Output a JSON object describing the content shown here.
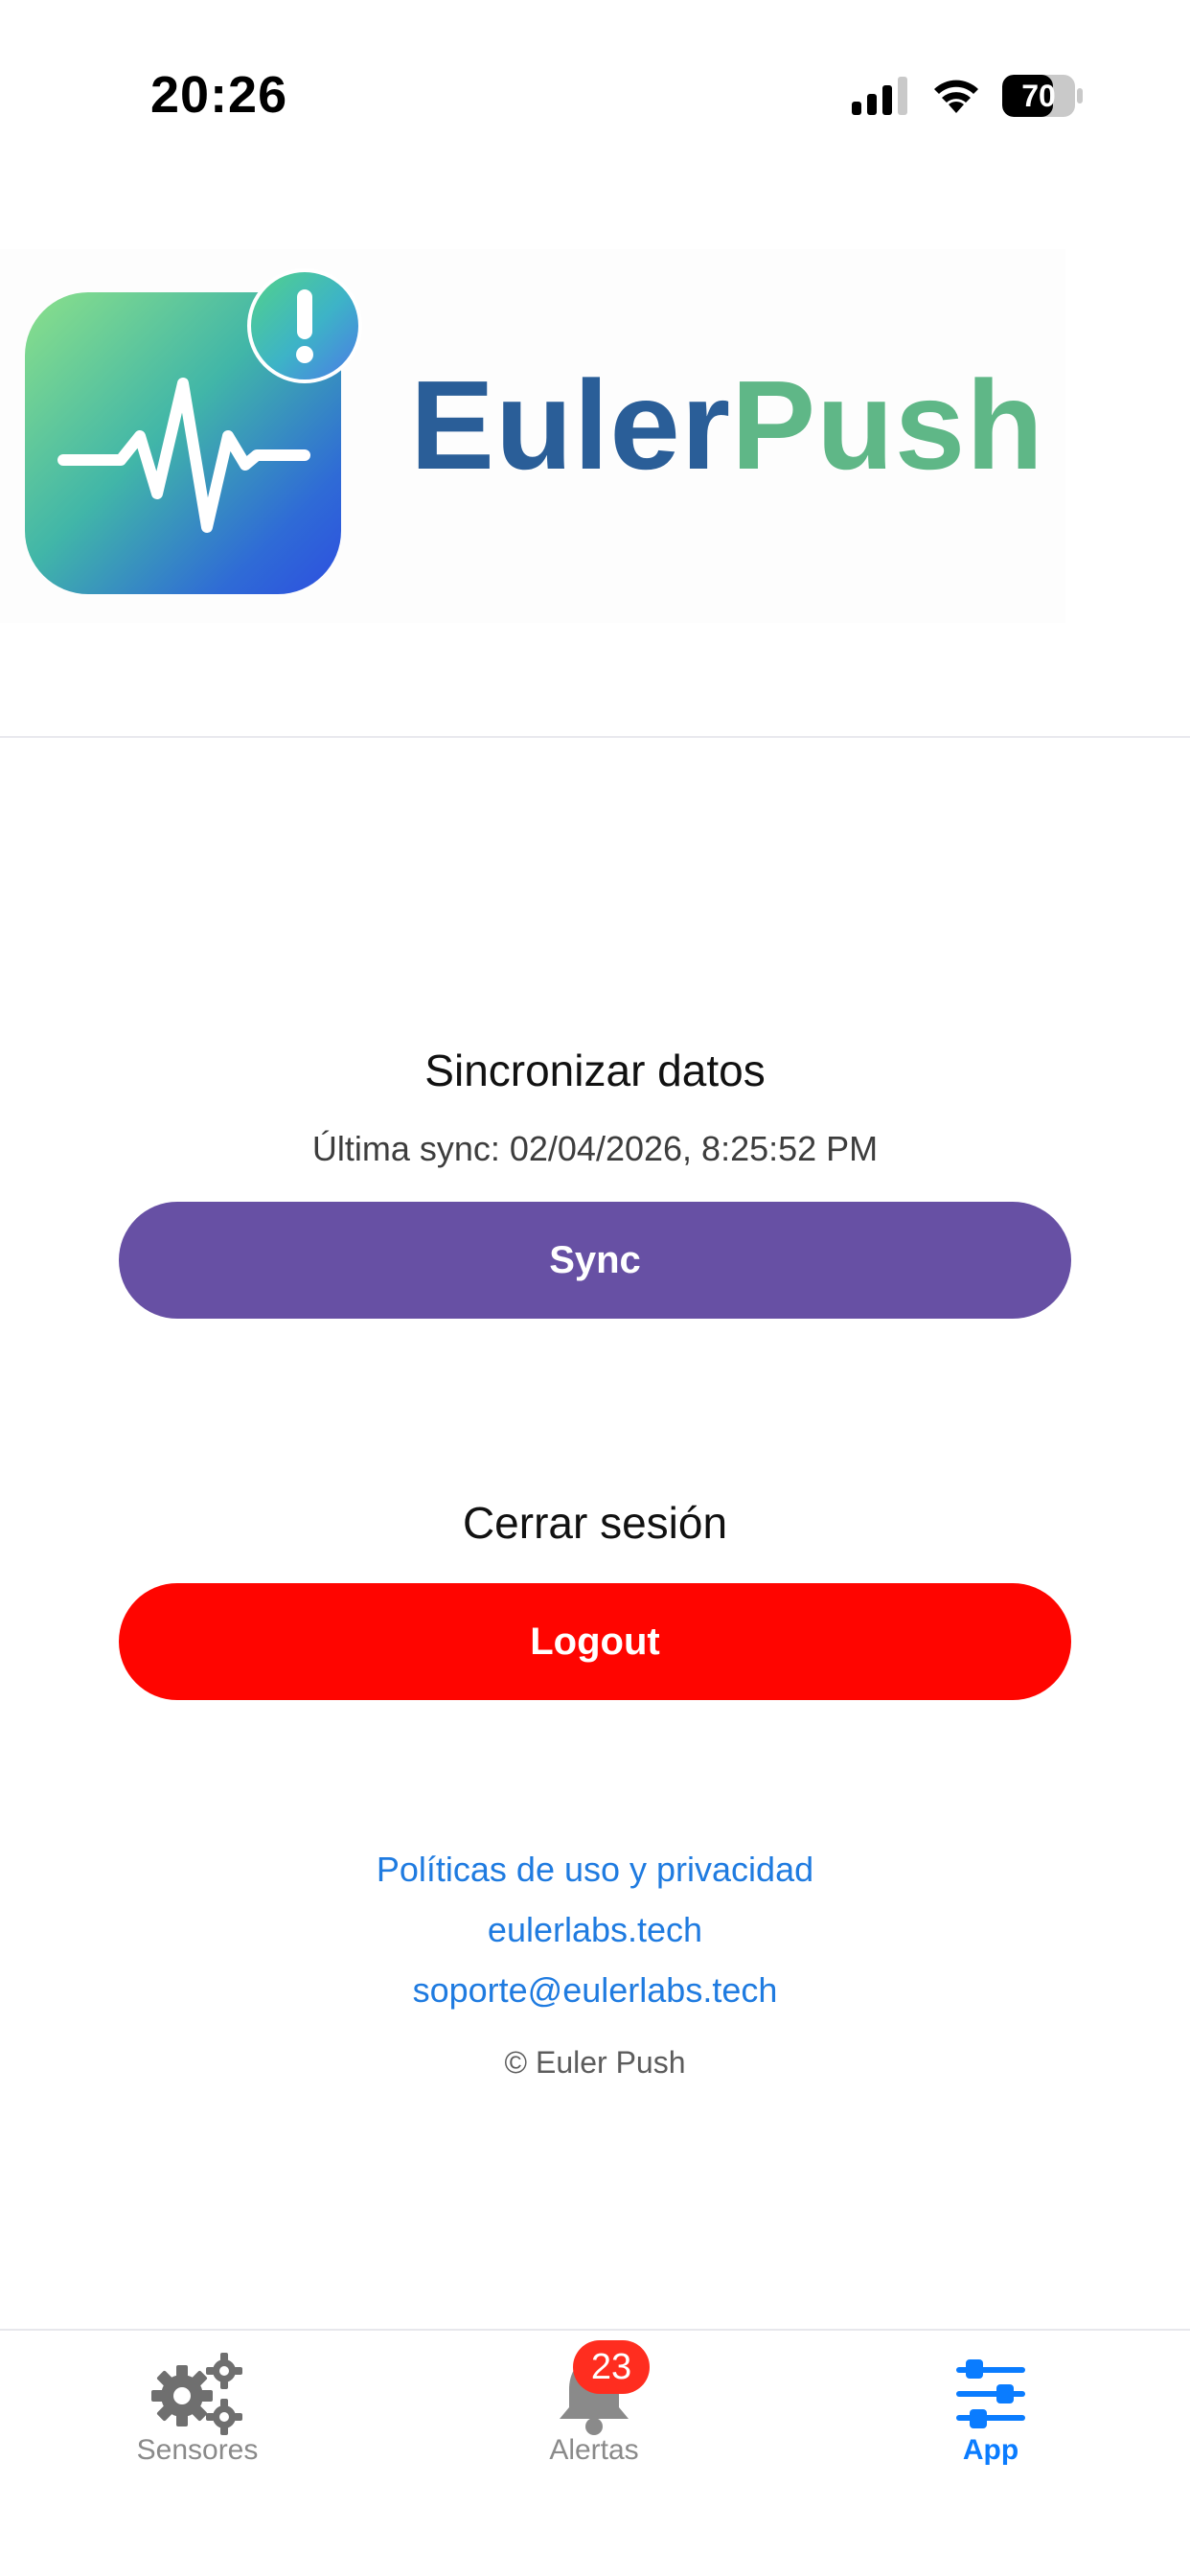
{
  "status_bar": {
    "time": "20:26",
    "battery": "70",
    "battery_level": 0.7
  },
  "header": {
    "brand_part1": "Euler",
    "brand_part2": "Push",
    "alert_mark": "!"
  },
  "sync": {
    "title": "Sincronizar datos",
    "last_sync": "Última sync: 02/04/2026, 8:25:52 PM",
    "button_label": "Sync",
    "button_color": "#6750a4"
  },
  "logout": {
    "title": "Cerrar sesión",
    "button_label": "Logout",
    "button_color": "#ff0500"
  },
  "links": {
    "privacy": "Políticas de uso y privacidad",
    "website": "eulerlabs.tech",
    "email": "soporte@eulerlabs.tech"
  },
  "copyright": "© Euler Push",
  "tabbar": {
    "items": [
      {
        "label": "Sensores",
        "icon": "gears-icon",
        "active": false
      },
      {
        "label": "Alertas",
        "icon": "bell-icon",
        "active": false,
        "badge": "23"
      },
      {
        "label": "App",
        "icon": "sliders-icon",
        "active": true
      }
    ],
    "active_color": "#0a7cff",
    "inactive_color": "#8a8a8a"
  }
}
